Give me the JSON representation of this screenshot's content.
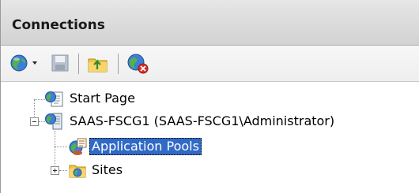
{
  "panel": {
    "title": "Connections"
  },
  "toolbar": {
    "buttons": [
      {
        "name": "connect-globe-icon",
        "has_dropdown": true
      },
      {
        "name": "save-icon"
      },
      {
        "name": "up-folder-icon"
      },
      {
        "name": "delete-connection-icon"
      }
    ]
  },
  "tree": {
    "nodes": [
      {
        "label": "Start Page",
        "icon": "start-page-icon",
        "level": 1,
        "selected": false
      },
      {
        "label": "SAAS-FSCG1 (SAAS-FSCG1\\Administrator)",
        "icon": "server-icon",
        "level": 1,
        "expanded": true,
        "selected": false
      },
      {
        "label": "Application Pools",
        "icon": "application-pools-icon",
        "level": 2,
        "selected": true
      },
      {
        "label": "Sites",
        "icon": "sites-folder-icon",
        "level": 2,
        "expanded": false,
        "selected": false
      }
    ]
  },
  "colors": {
    "selection": "#316ac5",
    "header_bg": "#d9d9d9"
  }
}
